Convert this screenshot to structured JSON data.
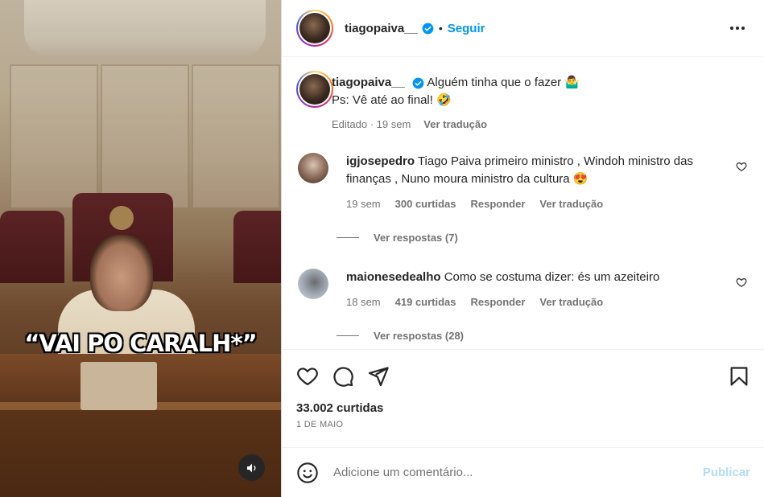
{
  "media": {
    "caption_overlay": "“VAI PO CARALH*”",
    "sound_icon": "speaker-icon"
  },
  "header": {
    "username": "tiagopaiva__",
    "separator": "•",
    "follow_label": "Seguir",
    "more_icon": "more-options-icon"
  },
  "post": {
    "username": "tiagopaiva__",
    "caption_line1": "Alguém tinha que o fazer 🤷‍♂️",
    "caption_line2": "Ps: Vê até ao final! 🤣",
    "edited": "Editado · 19 sem",
    "translate": "Ver tradução"
  },
  "comments": [
    {
      "username": "igjosepedro",
      "text": "Tiago Paiva primeiro ministro , Windoh ministro das finanças , Nuno moura ministro da cultura 😍",
      "time": "19 sem",
      "likes": "300 curtidas",
      "reply": "Responder",
      "translate": "Ver tradução",
      "view_replies": "Ver respostas (7)"
    },
    {
      "username": "maionesedealho",
      "text": "Como se costuma dizer: és um azeiteiro",
      "time": "18 sem",
      "likes": "419 curtidas",
      "reply": "Responder",
      "translate": "Ver tradução",
      "view_replies": "Ver respostas (28)"
    }
  ],
  "actions": {
    "likes": "33.002 curtidas",
    "date": "1 DE MAIO"
  },
  "add_comment": {
    "placeholder": "Adicione um comentário...",
    "publish": "Publicar"
  },
  "colors": {
    "accent": "#0095f6",
    "publish_disabled": "#b3dbff",
    "muted": "#737373",
    "text": "#262626"
  }
}
